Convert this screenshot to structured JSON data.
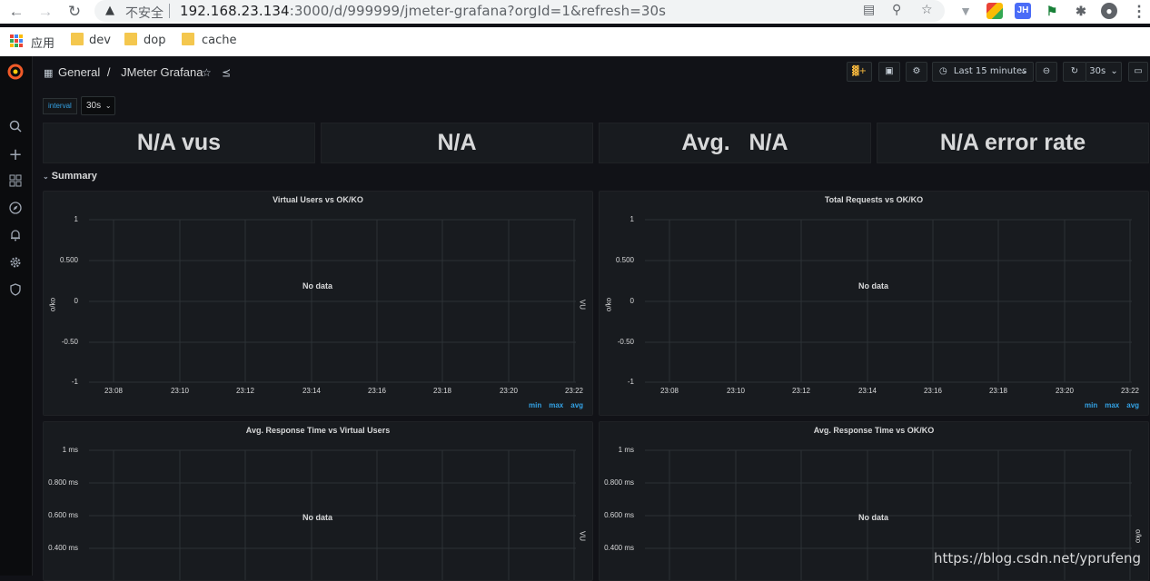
{
  "browser": {
    "insecure_label": "不安全",
    "url_host": "192.168.23.134",
    "url_path": ":3000/d/999999/jmeter-grafana?orgId=1&refresh=30s",
    "ext_jh": "JH",
    "bookmarks": {
      "apps_label": "应用",
      "items": [
        "dev",
        "dop",
        "cache"
      ]
    }
  },
  "dashboard": {
    "breadcrumb_folder": "General",
    "breadcrumb_separator": "/",
    "title": "JMeter Grafana",
    "time_range": "Last 15 minutes",
    "refresh_interval": "30s",
    "variable": {
      "label": "interval",
      "value": "30s"
    },
    "stats": [
      "N/A vus",
      "N/A",
      "Avg.   N/A",
      "N/A error rate"
    ],
    "row_title": "Summary",
    "panels": [
      {
        "title": "Virtual Users vs OK/KO",
        "no_data": "No data",
        "left_axis_label": "o/ko",
        "right_axis_label": "VU",
        "yticks": [
          "1",
          "0.500",
          "0",
          "-0.50",
          "-1"
        ],
        "xticks": [
          "23:08",
          "23:10",
          "23:12",
          "23:14",
          "23:16",
          "23:18",
          "23:20",
          "23:22"
        ],
        "legend": [
          "min",
          "max",
          "avg"
        ]
      },
      {
        "title": "Total Requests vs OK/KO",
        "no_data": "No data",
        "left_axis_label": "o/ko",
        "right_axis_label": "VU",
        "yticks": [
          "1",
          "0.500",
          "0",
          "-0.50",
          "-1"
        ],
        "xticks": [
          "23:08",
          "23:10",
          "23:12",
          "23:14",
          "23:16",
          "23:18",
          "23:20",
          "23:22"
        ],
        "legend": [
          "min",
          "max",
          "avg"
        ]
      },
      {
        "title": "Avg. Response Time vs Virtual Users",
        "no_data": "No data",
        "right_axis_label": "VU",
        "yticks": [
          "1 ms",
          "0.800 ms",
          "0.600 ms",
          "0.400 ms"
        ]
      },
      {
        "title": "Avg. Response Time vs OK/KO",
        "no_data": "No data",
        "right_axis_label": "o/ko",
        "yticks": [
          "1 ms",
          "0.800 ms",
          "0.600 ms",
          "0.400 ms"
        ]
      }
    ]
  },
  "watermark": "https://blog.csdn.net/yprufeng",
  "colors": {
    "grafana_bg": "#111217",
    "panel_bg": "#181b1f",
    "accent_blue": "#33a2e5",
    "grafana_logo": "#f05a28"
  }
}
